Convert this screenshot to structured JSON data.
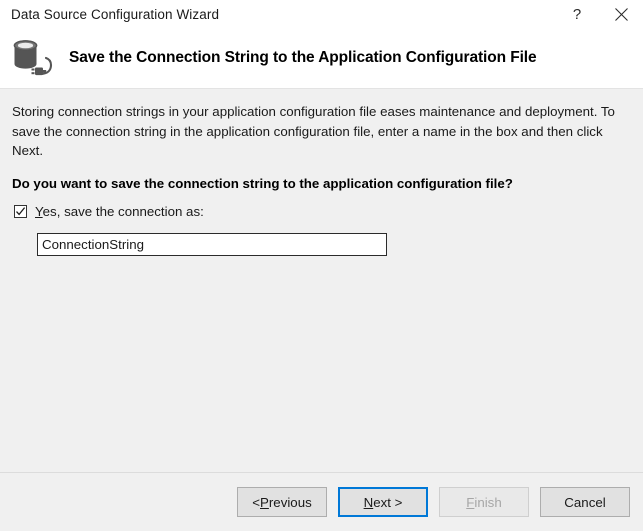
{
  "window": {
    "title": "Data Source Configuration Wizard",
    "help_icon": "question-mark-icon",
    "close_icon": "close-icon"
  },
  "header": {
    "icon": "database-connection-icon",
    "title": "Save the Connection String to the Application Configuration File"
  },
  "content": {
    "intro_paragraph": "Storing connection strings in your application configuration file eases maintenance and deployment. To save the connection string in the application configuration file, enter a name in the box and then click Next.",
    "question": "Do you want to save the connection string to the application configuration file?",
    "checkbox": {
      "checked": true,
      "accel": "Y",
      "label_rest": "es, save the connection as:",
      "full_label": "Yes, save the connection as:"
    },
    "connection_name_input": {
      "value": "ConnectionString",
      "placeholder": ""
    }
  },
  "footer": {
    "buttons": [
      {
        "name": "previous",
        "prefix": "< ",
        "accel": "P",
        "suffix": "revious",
        "label": "< Previous",
        "state": "enabled"
      },
      {
        "name": "next",
        "prefix": "",
        "accel": "N",
        "suffix": "ext >",
        "label": "Next >",
        "state": "default"
      },
      {
        "name": "finish",
        "prefix": "",
        "accel": "F",
        "suffix": "inish",
        "label": "Finish",
        "state": "disabled"
      },
      {
        "name": "cancel",
        "prefix": "",
        "accel": "",
        "suffix": "Cancel",
        "label": "Cancel",
        "state": "enabled"
      }
    ]
  },
  "colors": {
    "accent": "#0078d7",
    "content_bg": "#f0f0f0",
    "header_bg": "#ffffff",
    "text": "#1a1a1a",
    "disabled_text": "#a6a6a6"
  }
}
